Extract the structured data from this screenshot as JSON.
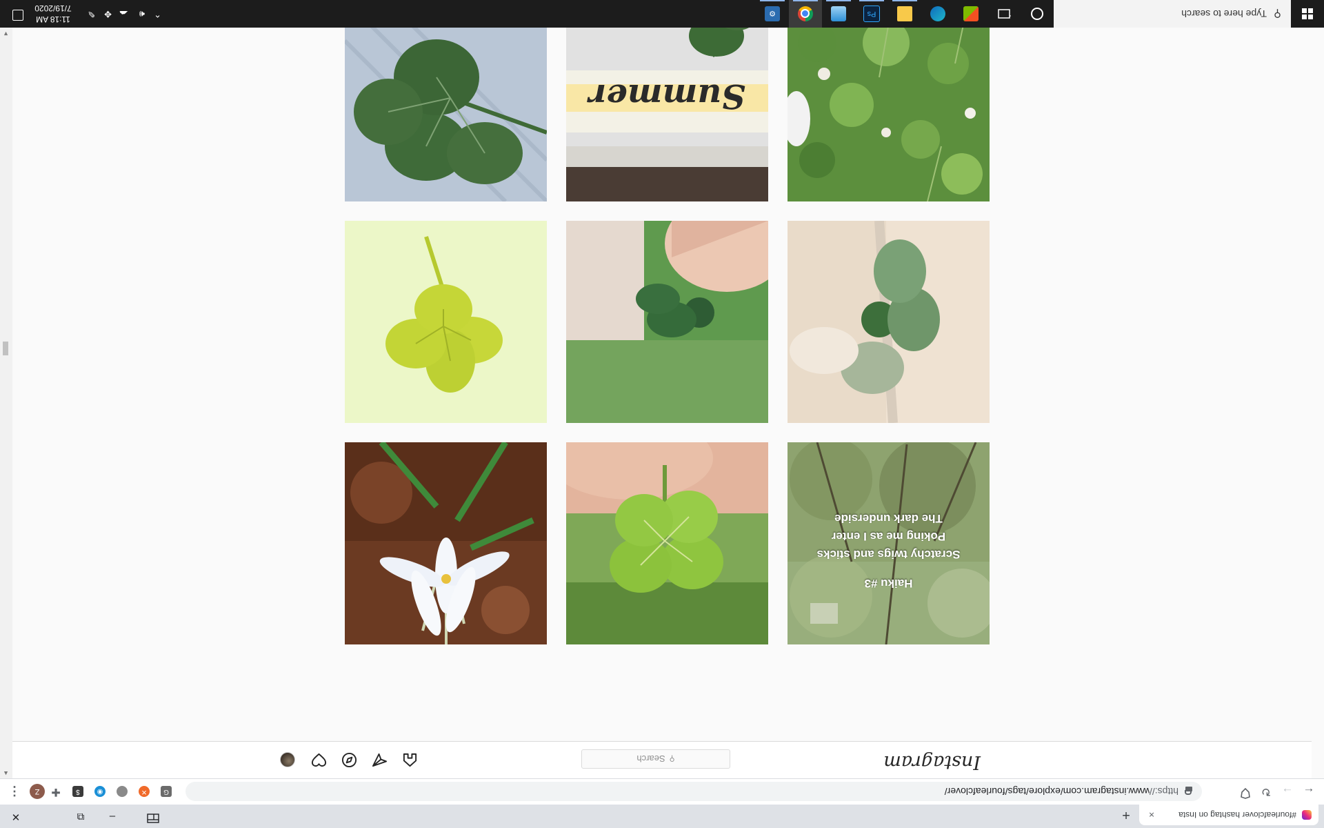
{
  "browser": {
    "tab_title": "#fourleafclover hashtag on Insta",
    "tab_close": "×",
    "new_tab": "+",
    "url_scheme": "https://",
    "url_rest": "www.instagram.com/explore/tags/fourleafclover/",
    "avatar_letter": "Z",
    "menu": "⋮",
    "window_minimize": "–",
    "window_restore": "⧉",
    "window_close": "✕"
  },
  "instagram": {
    "logo": "Instagram",
    "search_placeholder": "Search",
    "search_icon": "⚲"
  },
  "posts": [
    {
      "alt": "haiku-overlay",
      "caption_lines": [
        "Haiku #3",
        "Scratchy twigs and sticks",
        "Poking me as I enter",
        "The dark underside"
      ]
    },
    {
      "alt": "four-leaf-clover-held"
    },
    {
      "alt": "white-flower"
    },
    {
      "alt": "clover-on-concrete"
    },
    {
      "alt": "clover-between-fingers"
    },
    {
      "alt": "pressed-clover-yellow"
    },
    {
      "alt": "clover-patch"
    },
    {
      "alt": "clover-summer-text",
      "overlay_text": "Summer"
    },
    {
      "alt": "large-clover-on-fabric"
    },
    {
      "alt": "partial-sketch"
    },
    {
      "alt": "partial-wood"
    },
    {
      "alt": "partial-hand-clover"
    }
  ],
  "taskbar": {
    "search_placeholder": "Type here to search",
    "time": "11:18 AM",
    "date": "7/19/2020"
  }
}
